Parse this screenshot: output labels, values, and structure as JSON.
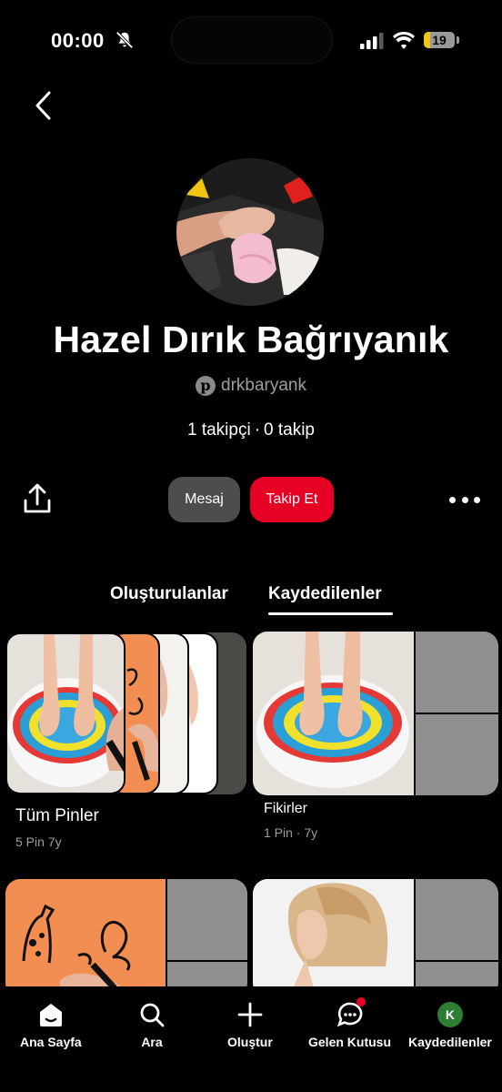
{
  "status_bar": {
    "time": "00:00",
    "battery": "19"
  },
  "profile": {
    "name": "Hazel Dırık Bağrıyanık",
    "handle": "drkbaryank",
    "followers": "1 takipçi",
    "separator": "·",
    "following": "0 takip"
  },
  "actions": {
    "message": "Mesaj",
    "follow": "Takip Et"
  },
  "tabs": [
    {
      "label": "Oluşturulanlar",
      "active": false
    },
    {
      "label": "Kaydedilenler",
      "active": true
    }
  ],
  "boards": [
    {
      "title": "Tüm Pinler",
      "meta": "5 Pin  7y"
    },
    {
      "title": "Fikirler",
      "meta": "1 Pin · 7y"
    }
  ],
  "bottom_nav": [
    {
      "label": "Ana Sayfa",
      "icon": "home-icon"
    },
    {
      "label": "Ara",
      "icon": "search-icon"
    },
    {
      "label": "Oluştur",
      "icon": "plus-icon"
    },
    {
      "label": "Gelen Kutusu",
      "icon": "chat-icon"
    },
    {
      "label": "Kaydedilenler",
      "icon": "avatar",
      "initial": "K"
    }
  ],
  "colors": {
    "accent": "#e60023",
    "message_button": "#4d4d4b",
    "background": "#000000"
  }
}
